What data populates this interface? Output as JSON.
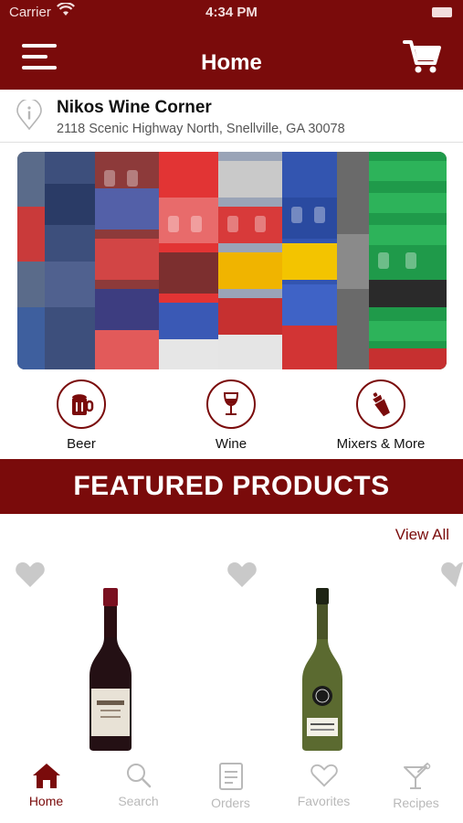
{
  "status_bar": {
    "carrier": "Carrier",
    "time": "4:34 PM"
  },
  "header": {
    "title": "Home"
  },
  "store": {
    "name": "Nikos Wine Corner",
    "address": "2118 Scenic Highway North, Snellville, GA 30078"
  },
  "categories": [
    {
      "label": "Beer",
      "icon": "beer-mug-icon"
    },
    {
      "label": "Wine",
      "icon": "wine-glass-icon"
    },
    {
      "label": "Mixers & More",
      "icon": "cocktail-shaker-icon"
    }
  ],
  "featured": {
    "title": "FEATURED PRODUCTS",
    "view_all": "View All"
  },
  "tabs": [
    {
      "label": "Home",
      "icon": "home-icon",
      "active": true
    },
    {
      "label": "Search",
      "icon": "search-icon",
      "active": false
    },
    {
      "label": "Orders",
      "icon": "orders-icon",
      "active": false
    },
    {
      "label": "Favorites",
      "icon": "heart-icon",
      "active": false
    },
    {
      "label": "Recipes",
      "icon": "cocktail-glass-icon",
      "active": false
    }
  ],
  "colors": {
    "brand": "#7a0b0b",
    "inactive": "#b9b9b9"
  }
}
